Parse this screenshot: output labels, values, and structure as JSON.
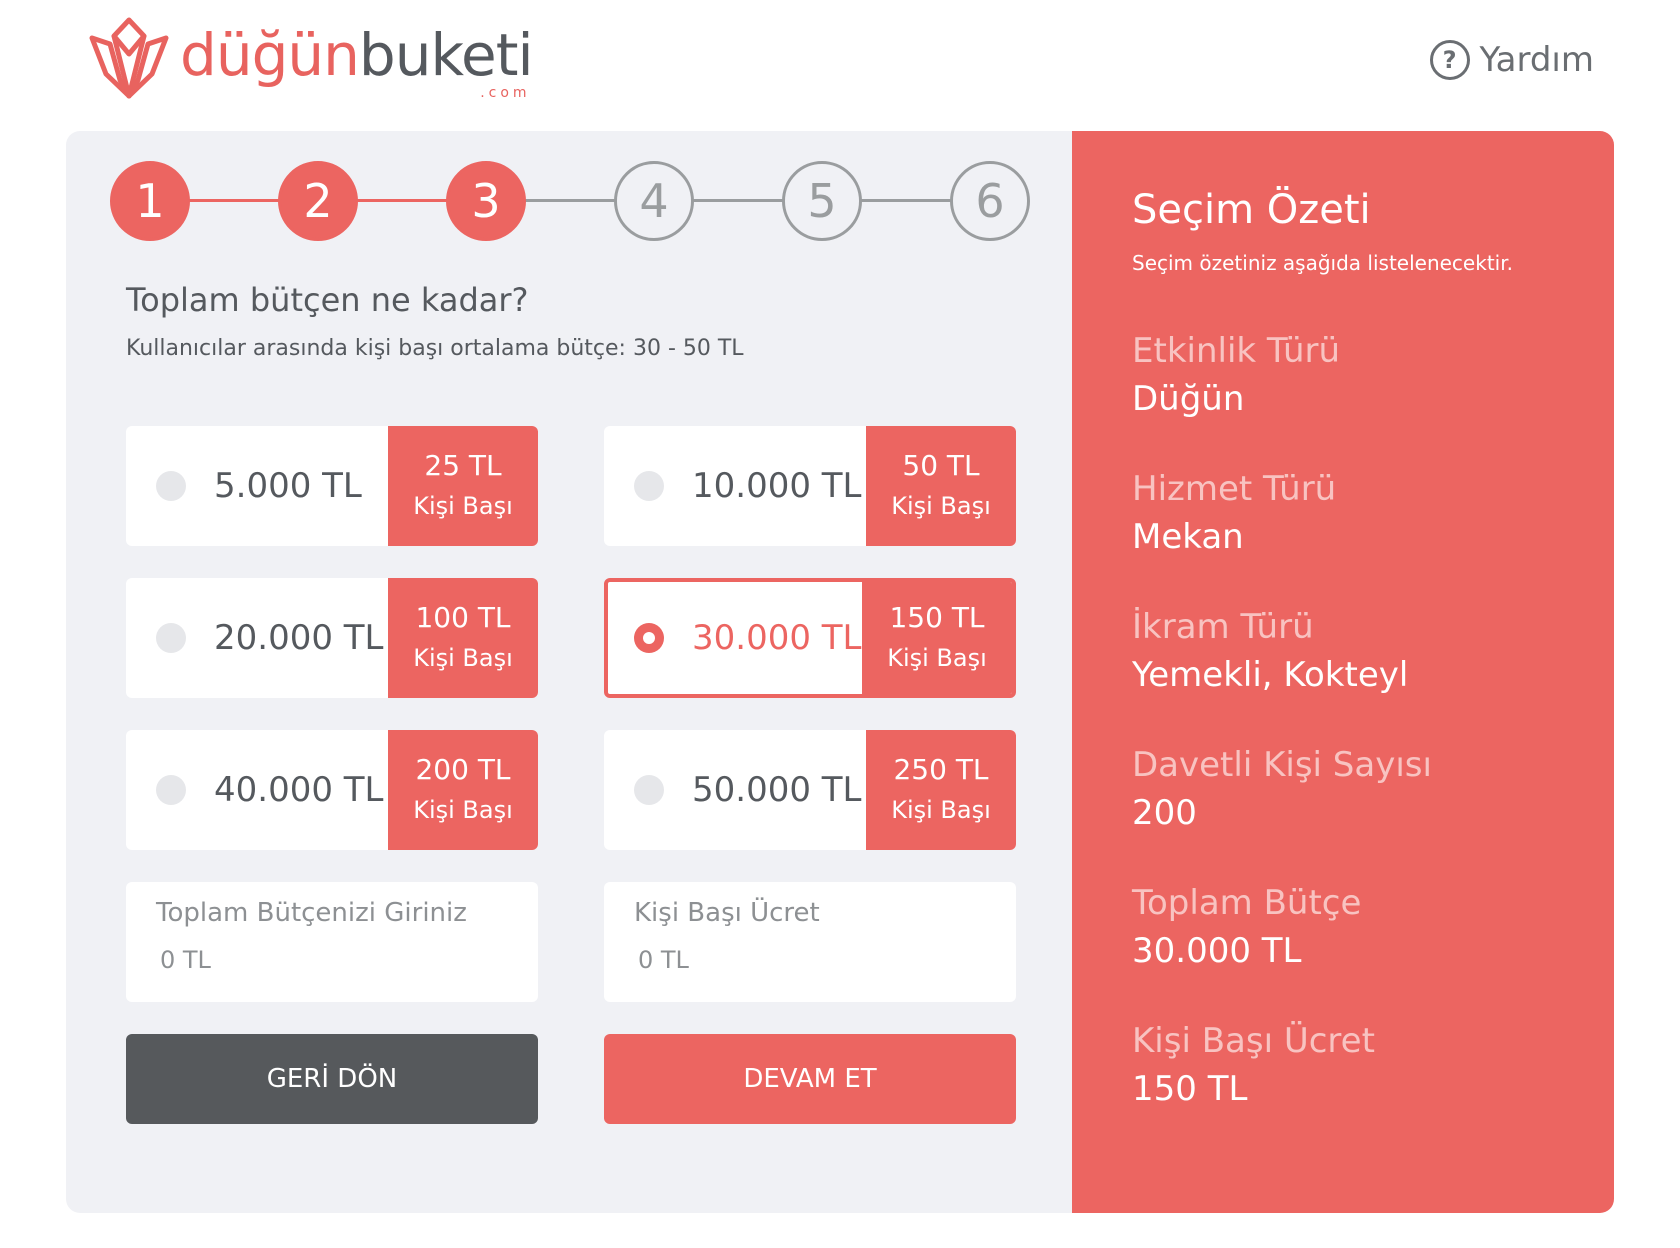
{
  "header": {
    "logo_text_1": "düğün",
    "logo_text_2": "buketi",
    "logo_com": ".com",
    "help_icon_glyph": "?",
    "help_label": "Yardım"
  },
  "stepper": {
    "steps": [
      "1",
      "2",
      "3",
      "4",
      "5",
      "6"
    ],
    "current_step": 3
  },
  "form": {
    "question": "Toplam bütçen ne kadar?",
    "subtext": "Kullanıcılar arasında kişi başı ortalama bütçe: 30 - 50 TL",
    "options": [
      {
        "amount": "5.000 TL",
        "per_value": "25 TL",
        "per_label": "Kişi Başı",
        "selected": false
      },
      {
        "amount": "10.000 TL",
        "per_value": "50 TL",
        "per_label": "Kişi Başı",
        "selected": false
      },
      {
        "amount": "20.000 TL",
        "per_value": "100 TL",
        "per_label": "Kişi Başı",
        "selected": false
      },
      {
        "amount": "30.000 TL",
        "per_value": "150 TL",
        "per_label": "Kişi Başı",
        "selected": true
      },
      {
        "amount": "40.000 TL",
        "per_value": "200 TL",
        "per_label": "Kişi Başı",
        "selected": false
      },
      {
        "amount": "50.000 TL",
        "per_value": "250 TL",
        "per_label": "Kişi Başı",
        "selected": false
      }
    ],
    "total_budget_field": {
      "label": "Toplam Bütçenizi Giriniz",
      "placeholder": "0 TL"
    },
    "per_person_field": {
      "label": "Kişi Başı Ücret",
      "placeholder": "0 TL"
    },
    "back_button": "GERİ DÖN",
    "next_button": "DEVAM ET"
  },
  "summary": {
    "title": "Seçim Özeti",
    "subtitle": "Seçim özetiniz aşağıda listelenecektir.",
    "items": [
      {
        "label": "Etkinlik Türü",
        "value": "Düğün"
      },
      {
        "label": "Hizmet Türü",
        "value": "Mekan"
      },
      {
        "label": "İkram Türü",
        "value": "Yemekli, Kokteyl"
      },
      {
        "label": "Davetli Kişi Sayısı",
        "value": "200"
      },
      {
        "label": "Toplam Bütçe",
        "value": "30.000 TL"
      },
      {
        "label": "Kişi Başı Ücret",
        "value": "150 TL"
      }
    ]
  },
  "colors": {
    "accent": "#ec6561",
    "dark_button": "#56595c",
    "panel_bg": "#f0f1f5",
    "text": "#55595e"
  }
}
